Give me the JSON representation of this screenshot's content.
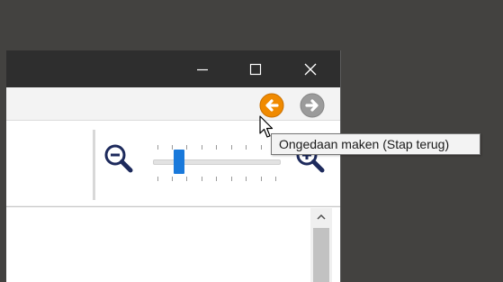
{
  "window": {
    "controls": [
      "minimize",
      "maximize",
      "close"
    ]
  },
  "toolbar": {
    "undo_icon": "undo-icon",
    "redo_icon": "redo-icon"
  },
  "zoom": {
    "slider_level": 0.18,
    "zoom_out_icon": "zoom-out-icon",
    "zoom_in_icon": "zoom-in-icon"
  },
  "tooltip": {
    "text": "Ongedaan maken (Stap terug)"
  },
  "colors": {
    "desktop": "#434240",
    "titlebar": "#2e2e2e",
    "undo_orange": "#f08a00",
    "redo_gray": "#9b9b9b",
    "slider_thumb": "#1979db",
    "zoom_icon_navy": "#1d2a5c"
  }
}
